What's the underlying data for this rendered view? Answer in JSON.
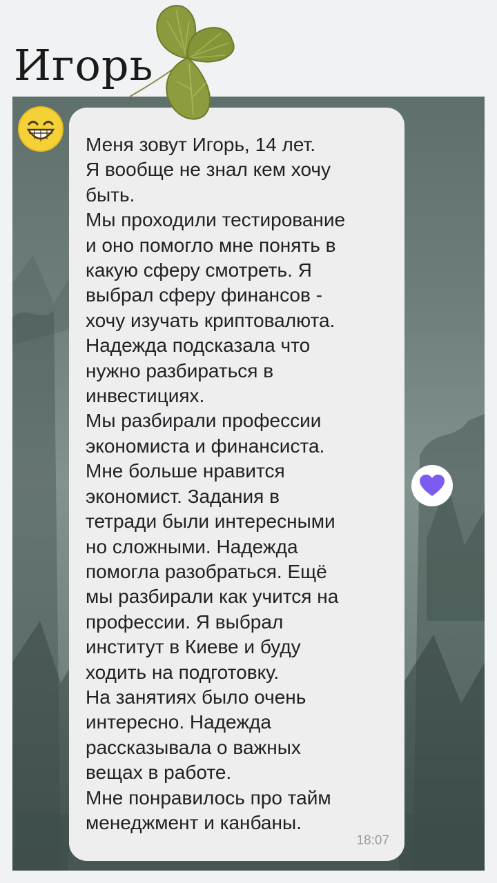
{
  "header": {
    "title": "Игорь"
  },
  "message": {
    "lines": [
      "Меня зовут Игорь, 14 лет.",
      "Я вообще не знал кем хочу",
      "быть.",
      "Мы проходили тестирование",
      "и оно помогло мне понять в",
      "какую сферу смотреть. Я",
      "выбрал сферу финансов -",
      "хочу изучать криптовалюта.",
      "Надежда подсказала что",
      "нужно разбираться в",
      "инвестициях.",
      "Мы разбирали профессии",
      "экономиста и финансиста.",
      "Мне больше нравится",
      "экономист. Задания в",
      "тетради были интересными",
      "но сложными. Надежда",
      "помогла разобраться. Ещё",
      "мы разбирали как учится на",
      "профессии. Я выбрал",
      "институт в Киеве и буду",
      "ходить на подготовку.",
      "На занятиях было очень",
      "интересно. Надежда",
      "рассказывала о важных",
      "вещах в работе.",
      "Мне понравилось про тайм",
      "менеджмент и канбаны."
    ],
    "time": "18:07",
    "avatar_icon": "grinning-face-icon",
    "reaction_icon": "purple-heart-icon"
  },
  "colors": {
    "page_bg": "#f0f2f4",
    "bubble_bg": "#eeeeef",
    "heart": "#7c5cf0",
    "avatar": "#f4d237"
  }
}
